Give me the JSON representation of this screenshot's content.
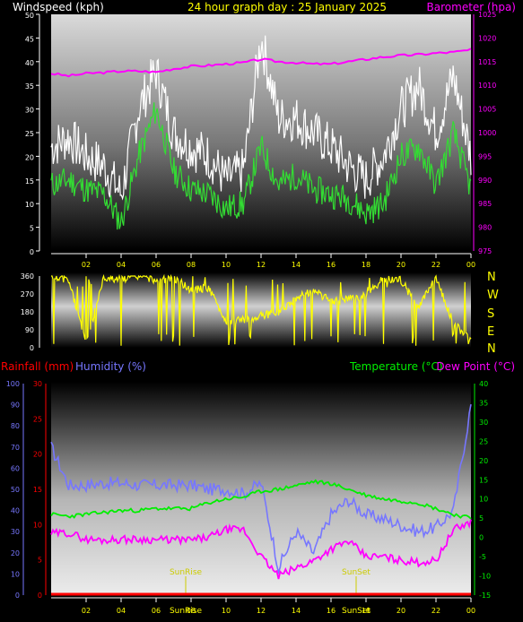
{
  "header": {
    "left_title": "Windspeed (kph)",
    "center_title": "24 hour graph day : 25 January 2025",
    "right_title": "Barometer (hpa)"
  },
  "colors": {
    "background": "#000000",
    "wind_gust": "#ffffff",
    "wind_avg": "#33dd33",
    "barometer": "#ff00ff",
    "direction": "#ffff00",
    "rainfall": "#ff0000",
    "humidity": "#7777ff",
    "temperature": "#00ee00",
    "dew_point": "#ff00ff",
    "time_ticks": "#ffff00",
    "axis_text": "#ffffff"
  },
  "time_labels": [
    "02",
    "04",
    "06",
    "08",
    "10",
    "12",
    "14",
    "16",
    "18",
    "20",
    "22",
    "00"
  ],
  "direction_compass": [
    "N",
    "W",
    "S",
    "E",
    "N"
  ],
  "bottom_header": {
    "rainfall": "Rainfall (mm)",
    "humidity": "Humidity (%)",
    "temperature": "Temperature (°C)",
    "dew_point": "Dew Point (°C)"
  },
  "sun_labels": {
    "sunrise": "SunRise",
    "sunset": "SunSet"
  },
  "chart_data": [
    {
      "type": "line",
      "title": "24 hour graph day : 25 January 2025",
      "ylabel": "Windspeed (kph)",
      "ylim": [
        0,
        50
      ],
      "y_ticks": [
        0,
        5,
        10,
        15,
        20,
        25,
        30,
        35,
        40,
        45,
        50
      ],
      "y2label": "Barometer (hpa)",
      "y2lim": [
        975,
        1025
      ],
      "y2_ticks": [
        975,
        980,
        985,
        990,
        995,
        1000,
        1005,
        1010,
        1015,
        1020,
        1025
      ],
      "x_hours": [
        0,
        1,
        2,
        3,
        4,
        5,
        6,
        7,
        8,
        9,
        10,
        11,
        12,
        13,
        14,
        15,
        16,
        17,
        18,
        19,
        20,
        21,
        22,
        23,
        24
      ],
      "series": [
        {
          "name": "Windspeed",
          "values": [
            14,
            15,
            13,
            12,
            6,
            20,
            30,
            17,
            13,
            12,
            9,
            10,
            22,
            14,
            16,
            13,
            12,
            11,
            8,
            10,
            20,
            22,
            14,
            25,
            13
          ]
        },
        {
          "name": "Gust",
          "values": [
            22,
            24,
            20,
            18,
            12,
            30,
            38,
            25,
            22,
            20,
            15,
            17,
            45,
            28,
            28,
            25,
            22,
            18,
            15,
            20,
            30,
            35,
            25,
            37,
            20
          ]
        },
        {
          "name": "Barometer",
          "values": [
            1012.5,
            1012,
            1012.5,
            1012.7,
            1013,
            1013,
            1012.8,
            1013.5,
            1014,
            1014.2,
            1014.5,
            1014.8,
            1015.5,
            1015,
            1014.8,
            1014.5,
            1014.5,
            1015,
            1015.5,
            1016,
            1016.3,
            1016.5,
            1016.8,
            1017,
            1017.5
          ]
        }
      ]
    },
    {
      "type": "line",
      "ylim": [
        0,
        360
      ],
      "y_ticks": [
        0,
        90,
        180,
        270,
        360
      ],
      "x_hours": [
        0,
        1,
        2,
        3,
        4,
        5,
        6,
        7,
        8,
        9,
        10,
        11,
        12,
        13,
        14,
        15,
        16,
        17,
        18,
        19,
        20,
        21,
        22,
        23,
        24
      ],
      "series": [
        {
          "name": "Wind direction",
          "values": [
            350,
            340,
            20,
            350,
            345,
            360,
            340,
            350,
            290,
            300,
            130,
            140,
            160,
            180,
            250,
            290,
            230,
            250,
            260,
            350,
            340,
            200,
            350,
            120,
            40
          ]
        }
      ]
    },
    {
      "type": "line",
      "y_humidity_ticks": [
        0,
        10,
        20,
        30,
        40,
        50,
        60,
        70,
        80,
        90,
        100
      ],
      "y_rain_ticks": [
        0,
        5,
        10,
        15,
        20,
        25,
        30
      ],
      "y_temp_ticks": [
        -15,
        -10,
        -5,
        0,
        5,
        10,
        15,
        20,
        25,
        30,
        35,
        40
      ],
      "x_hours": [
        0,
        1,
        2,
        3,
        4,
        5,
        6,
        7,
        8,
        9,
        10,
        11,
        12,
        13,
        14,
        15,
        16,
        17,
        18,
        19,
        20,
        21,
        22,
        23,
        24
      ],
      "series": [
        {
          "name": "Temperature",
          "values": [
            6,
            5.5,
            6,
            6.5,
            7,
            7,
            7.5,
            7.5,
            7.5,
            9,
            10,
            10.5,
            12,
            12.5,
            13.5,
            14.5,
            14,
            12.5,
            11,
            10,
            9.5,
            9,
            7.5,
            6,
            5
          ]
        },
        {
          "name": "Dew Point",
          "values": [
            1,
            1.2,
            -0.5,
            -0.7,
            -0.5,
            -0.5,
            -0.6,
            -0.6,
            -0.7,
            0,
            2,
            2,
            -5,
            -10,
            -8,
            -6,
            -3,
            -1,
            -5,
            -5,
            -6,
            -6.5,
            -6,
            2,
            4
          ]
        },
        {
          "name": "Humidity",
          "values": [
            70,
            52,
            52,
            53,
            53,
            52,
            52,
            52,
            52,
            50,
            50,
            48,
            53,
            13,
            30,
            20,
            38,
            45,
            38,
            36,
            33,
            30,
            32,
            40,
            90
          ]
        },
        {
          "name": "Rainfall",
          "values": [
            0,
            0,
            0,
            0,
            0,
            0,
            0,
            0,
            0,
            0,
            0,
            0,
            0,
            0,
            0,
            0,
            0,
            0,
            0,
            0,
            0,
            0,
            0,
            0,
            0
          ]
        }
      ]
    }
  ]
}
